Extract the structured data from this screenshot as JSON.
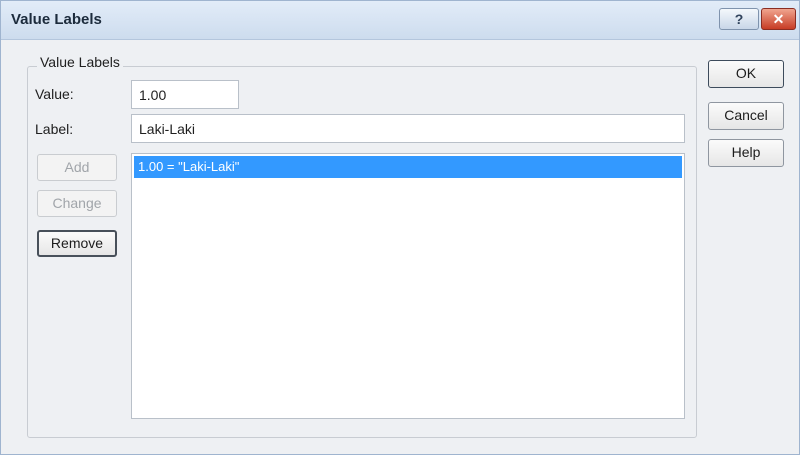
{
  "window": {
    "title": "Value Labels",
    "help_glyph": "?",
    "close_glyph": "✕"
  },
  "group": {
    "title": "Value Labels"
  },
  "fields": {
    "value_label": "Value:",
    "value": "1.00",
    "label_label": "Label:",
    "label": "Laki-Laki"
  },
  "list": {
    "items": [
      "1.00 = \"Laki-Laki\""
    ],
    "selected_index": 0
  },
  "buttons": {
    "add": "Add",
    "change": "Change",
    "remove": "Remove",
    "ok": "OK",
    "cancel": "Cancel",
    "help": "Help"
  },
  "colors": {
    "selection": "#3399ff",
    "close_button": "#c73c25"
  }
}
